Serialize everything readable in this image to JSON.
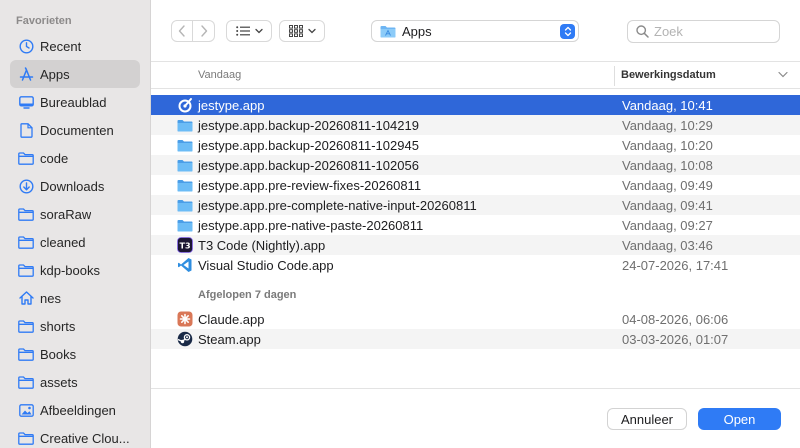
{
  "sidebar": {
    "section_title": "Favorieten",
    "items": [
      {
        "label": "Recent",
        "icon": "clock-icon"
      },
      {
        "label": "Apps",
        "icon": "apps-icon"
      },
      {
        "label": "Bureaublad",
        "icon": "desktop-icon"
      },
      {
        "label": "Documenten",
        "icon": "document-icon"
      },
      {
        "label": "code",
        "icon": "folder-icon"
      },
      {
        "label": "Downloads",
        "icon": "download-icon"
      },
      {
        "label": "soraRaw",
        "icon": "folder-icon"
      },
      {
        "label": "cleaned",
        "icon": "folder-icon"
      },
      {
        "label": "kdp-books",
        "icon": "folder-icon"
      },
      {
        "label": "nes",
        "icon": "home-icon"
      },
      {
        "label": "shorts",
        "icon": "folder-icon"
      },
      {
        "label": "Books",
        "icon": "folder-icon"
      },
      {
        "label": "assets",
        "icon": "folder-icon"
      },
      {
        "label": "Afbeeldingen",
        "icon": "pictures-icon"
      },
      {
        "label": "Creative Clou...",
        "icon": "folder-icon"
      }
    ],
    "selected_label": "Apps"
  },
  "toolbar": {
    "location_label": "Apps",
    "search_placeholder": "Zoek"
  },
  "columns": {
    "name_header": "Vandaag",
    "date_header": "Bewerkingsdatum"
  },
  "sections": [
    {
      "title": "",
      "rows": [
        {
          "name": "jestype.app",
          "date": "Vandaag, 10:41",
          "icon": "jestype-app-icon",
          "selected": true
        },
        {
          "name": "jestype.app.backup-20260811-104219",
          "date": "Vandaag, 10:29",
          "icon": "folder-icon"
        },
        {
          "name": "jestype.app.backup-20260811-102945",
          "date": "Vandaag, 10:20",
          "icon": "folder-icon"
        },
        {
          "name": "jestype.app.backup-20260811-102056",
          "date": "Vandaag, 10:08",
          "icon": "folder-icon"
        },
        {
          "name": "jestype.app.pre-review-fixes-20260811",
          "date": "Vandaag, 09:49",
          "icon": "folder-icon"
        },
        {
          "name": "jestype.app.pre-complete-native-input-20260811",
          "date": "Vandaag, 09:41",
          "icon": "folder-icon"
        },
        {
          "name": "jestype.app.pre-native-paste-20260811",
          "date": "Vandaag, 09:27",
          "icon": "folder-icon"
        },
        {
          "name": "T3 Code (Nightly).app",
          "date": "Vandaag, 03:46",
          "icon": "t3-code-app-icon"
        },
        {
          "name": "Visual Studio Code.app",
          "date": "24-07-2026, 17:41",
          "icon": "vscode-app-icon"
        }
      ]
    },
    {
      "title": "Afgelopen 7 dagen",
      "rows": [
        {
          "name": "Claude.app",
          "date": "04-08-2026, 06:06",
          "icon": "claude-app-icon"
        },
        {
          "name": "Steam.app",
          "date": "03-03-2026, 01:07",
          "icon": "steam-app-icon"
        }
      ]
    }
  ],
  "buttons": {
    "cancel_label": "Annuleer",
    "open_label": "Open"
  },
  "colors": {
    "accent": "#2f7bf5",
    "selection": "#2f67d9",
    "folder": "#5aaaf0",
    "sidebar_bg": "#e8e6e6"
  }
}
